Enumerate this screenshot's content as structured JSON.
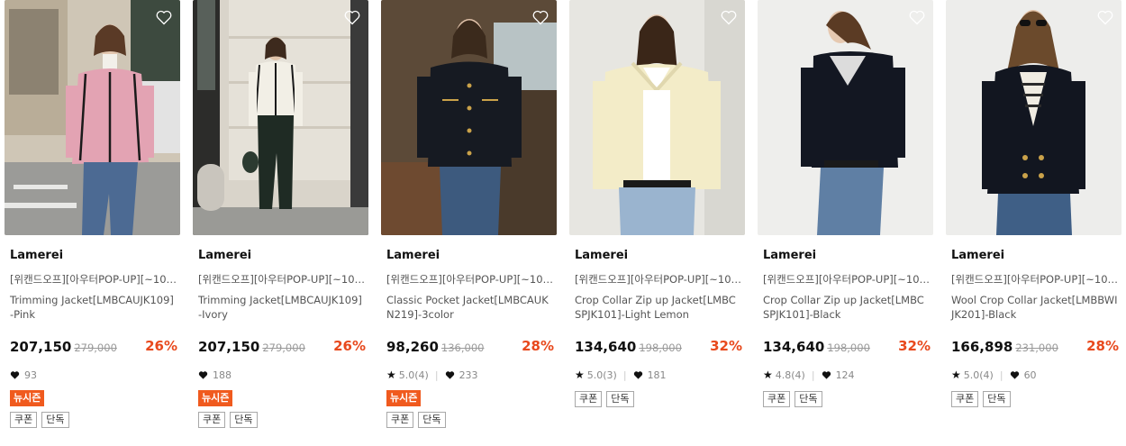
{
  "products": [
    {
      "brand": "Lamerei",
      "promo": "[위캔드오프][아우터POP-UP][~10/2...",
      "name": "Trimming Jacket[LMBCAUJK109]-Pink",
      "price": "207,150",
      "original_price": "279,000",
      "discount": "26%",
      "rating": "",
      "likes": "93",
      "badge": "뉴시즌",
      "tags": [
        "쿠폰",
        "단독"
      ],
      "image": "pink-tweed-jacket-street-photo",
      "wishlist_icon": "heart-outline-icon"
    },
    {
      "brand": "Lamerei",
      "promo": "[위캔드오프][아우터POP-UP][~10/2...",
      "name": "Trimming Jacket[LMBCAUJK109]-Ivory",
      "price": "207,150",
      "original_price": "279,000",
      "discount": "26%",
      "rating": "",
      "likes": "188",
      "badge": "뉴시즌",
      "tags": [
        "쿠폰",
        "단독"
      ],
      "image": "ivory-tweed-jacket-street-photo",
      "wishlist_icon": "heart-outline-icon"
    },
    {
      "brand": "Lamerei",
      "promo": "[위캔드오프][아우터POP-UP][~10/2...",
      "name": "Classic Pocket Jacket[LMBCAUKN219]-3color",
      "price": "98,260",
      "original_price": "136,000",
      "discount": "28%",
      "rating": "5.0(4)",
      "likes": "233",
      "badge": "뉴시즌",
      "tags": [
        "쿠폰",
        "단독"
      ],
      "image": "black-knit-jacket-studio-photo",
      "wishlist_icon": "heart-outline-icon"
    },
    {
      "brand": "Lamerei",
      "promo": "[위캔드오프][아우터POP-UP][~10/2...",
      "name": "Crop Collar Zip up Jacket[LMBCSPJK101]-Light Lemon",
      "price": "134,640",
      "original_price": "198,000",
      "discount": "32%",
      "rating": "5.0(3)",
      "likes": "181",
      "badge": "",
      "tags": [
        "쿠폰",
        "단독"
      ],
      "image": "light-lemon-collar-jacket-photo",
      "wishlist_icon": "heart-outline-icon"
    },
    {
      "brand": "Lamerei",
      "promo": "[위캔드오프][아우터POP-UP][~10/2...",
      "name": "Crop Collar Zip up Jacket[LMBCSPJK101]-Black",
      "price": "134,640",
      "original_price": "198,000",
      "discount": "32%",
      "rating": "4.8(4)",
      "likes": "124",
      "badge": "",
      "tags": [
        "쿠폰",
        "단독"
      ],
      "image": "black-collar-jacket-photo",
      "wishlist_icon": "heart-outline-icon"
    },
    {
      "brand": "Lamerei",
      "promo": "[위캔드오프][아우터POP-UP][~10/2...",
      "name": "Wool Crop Collar Jacket[LMBBWIJK201]-Black",
      "price": "166,898",
      "original_price": "231,000",
      "discount": "28%",
      "rating": "5.0(4)",
      "likes": "60",
      "badge": "",
      "tags": [
        "쿠폰",
        "단독"
      ],
      "image": "black-wool-jacket-photo",
      "wishlist_icon": "heart-outline-icon"
    }
  ],
  "colors": {
    "discount": "#e8491d",
    "badge_bg": "#f05a1e",
    "text": "#111111",
    "muted": "#888888"
  }
}
